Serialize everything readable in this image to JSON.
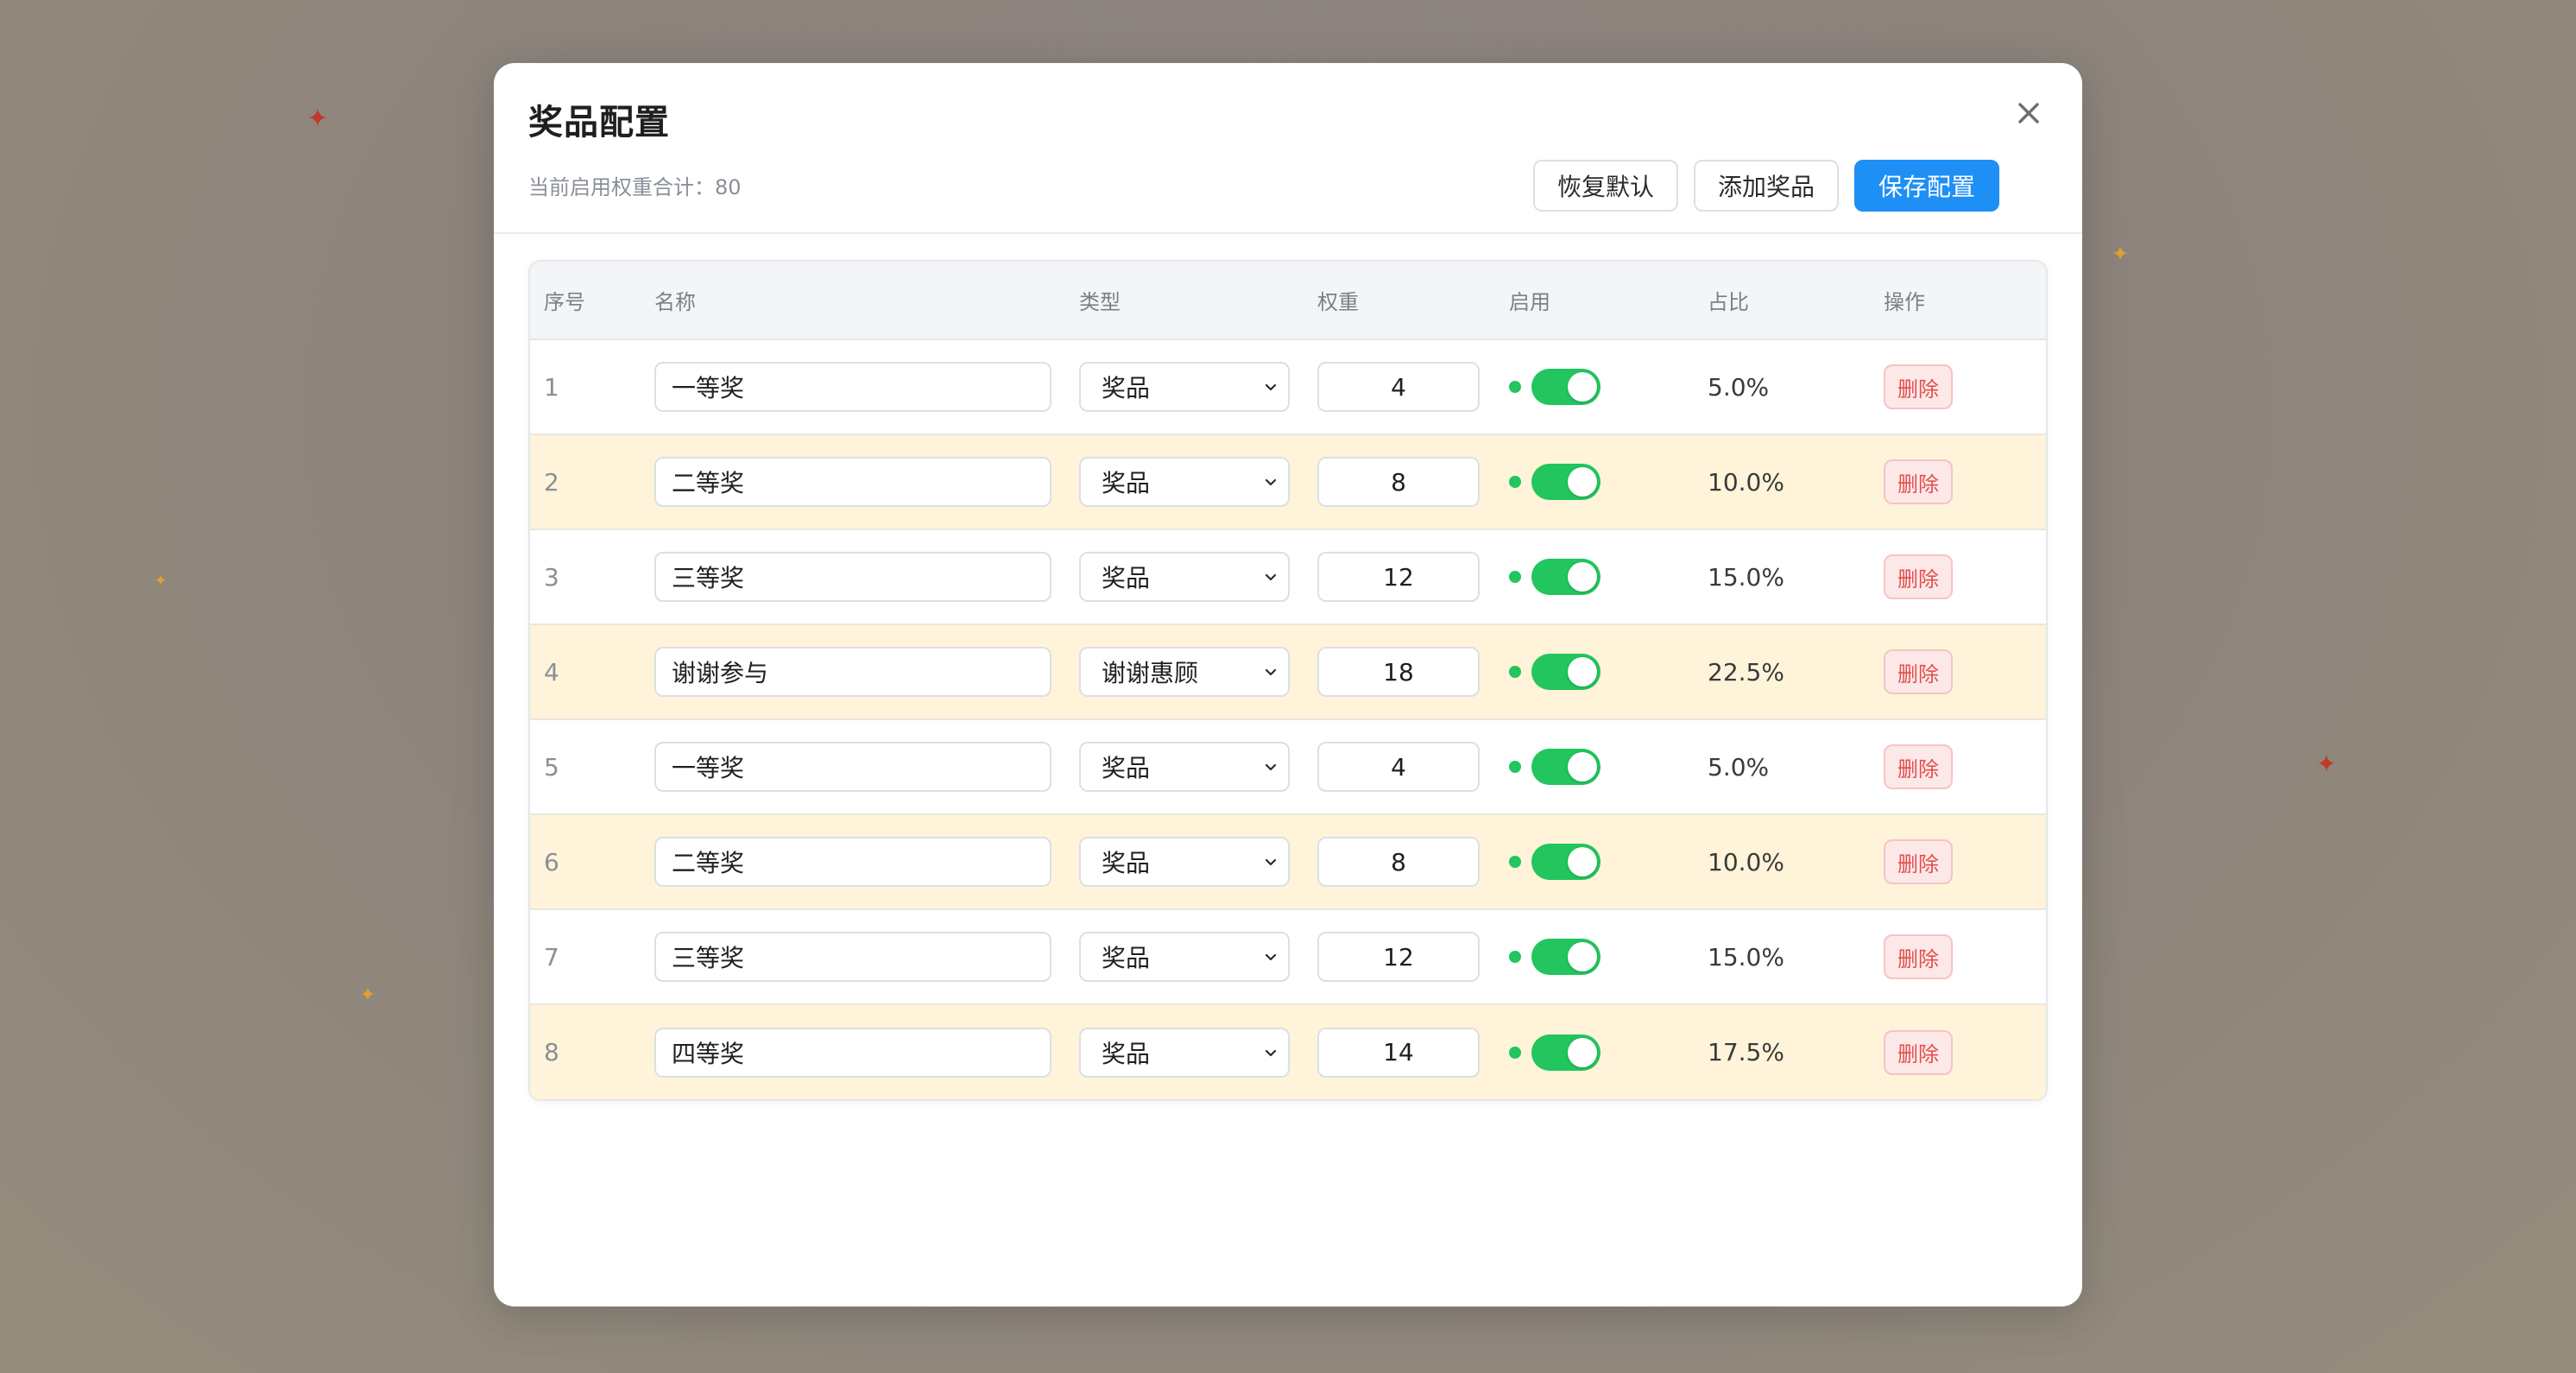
{
  "theme": {
    "primary": "#1e8ff4",
    "success": "#22c55e",
    "danger": "#e0504e",
    "row_highlight": "#fff4d9"
  },
  "modal": {
    "title": "奖品配置",
    "weight_summary": "当前启用权重合计：80",
    "close_icon": "close-icon"
  },
  "toolbar": {
    "reset_label": "恢复默认",
    "add_label": "添加奖品",
    "save_label": "保存配置"
  },
  "table": {
    "columns": [
      "序号",
      "名称",
      "类型",
      "权重",
      "启用",
      "占比",
      "操作"
    ],
    "rows": [
      {
        "index": "1",
        "name": "一等奖",
        "type": "奖品",
        "weight": "4",
        "enabled": true,
        "ratio": "5.0%",
        "action": "删除"
      },
      {
        "index": "2",
        "name": "二等奖",
        "type": "奖品",
        "weight": "8",
        "enabled": true,
        "ratio": "10.0%",
        "action": "删除"
      },
      {
        "index": "3",
        "name": "三等奖",
        "type": "奖品",
        "weight": "12",
        "enabled": true,
        "ratio": "15.0%",
        "action": "删除"
      },
      {
        "index": "4",
        "name": "谢谢参与",
        "type": "谢谢惠顾",
        "weight": "18",
        "enabled": true,
        "ratio": "22.5%",
        "action": "删除"
      },
      {
        "index": "5",
        "name": "一等奖",
        "type": "奖品",
        "weight": "4",
        "enabled": true,
        "ratio": "5.0%",
        "action": "删除"
      },
      {
        "index": "6",
        "name": "二等奖",
        "type": "奖品",
        "weight": "8",
        "enabled": true,
        "ratio": "10.0%",
        "action": "删除"
      },
      {
        "index": "7",
        "name": "三等奖",
        "type": "奖品",
        "weight": "12",
        "enabled": true,
        "ratio": "15.0%",
        "action": "删除"
      },
      {
        "index": "8",
        "name": "四等奖",
        "type": "奖品",
        "weight": "14",
        "enabled": true,
        "ratio": "17.5%",
        "action": "删除"
      }
    ]
  },
  "background": {
    "sparkle_icon": "sparkle-icon",
    "sparkle_colors": [
      "#c0392b",
      "#e0a030"
    ]
  }
}
